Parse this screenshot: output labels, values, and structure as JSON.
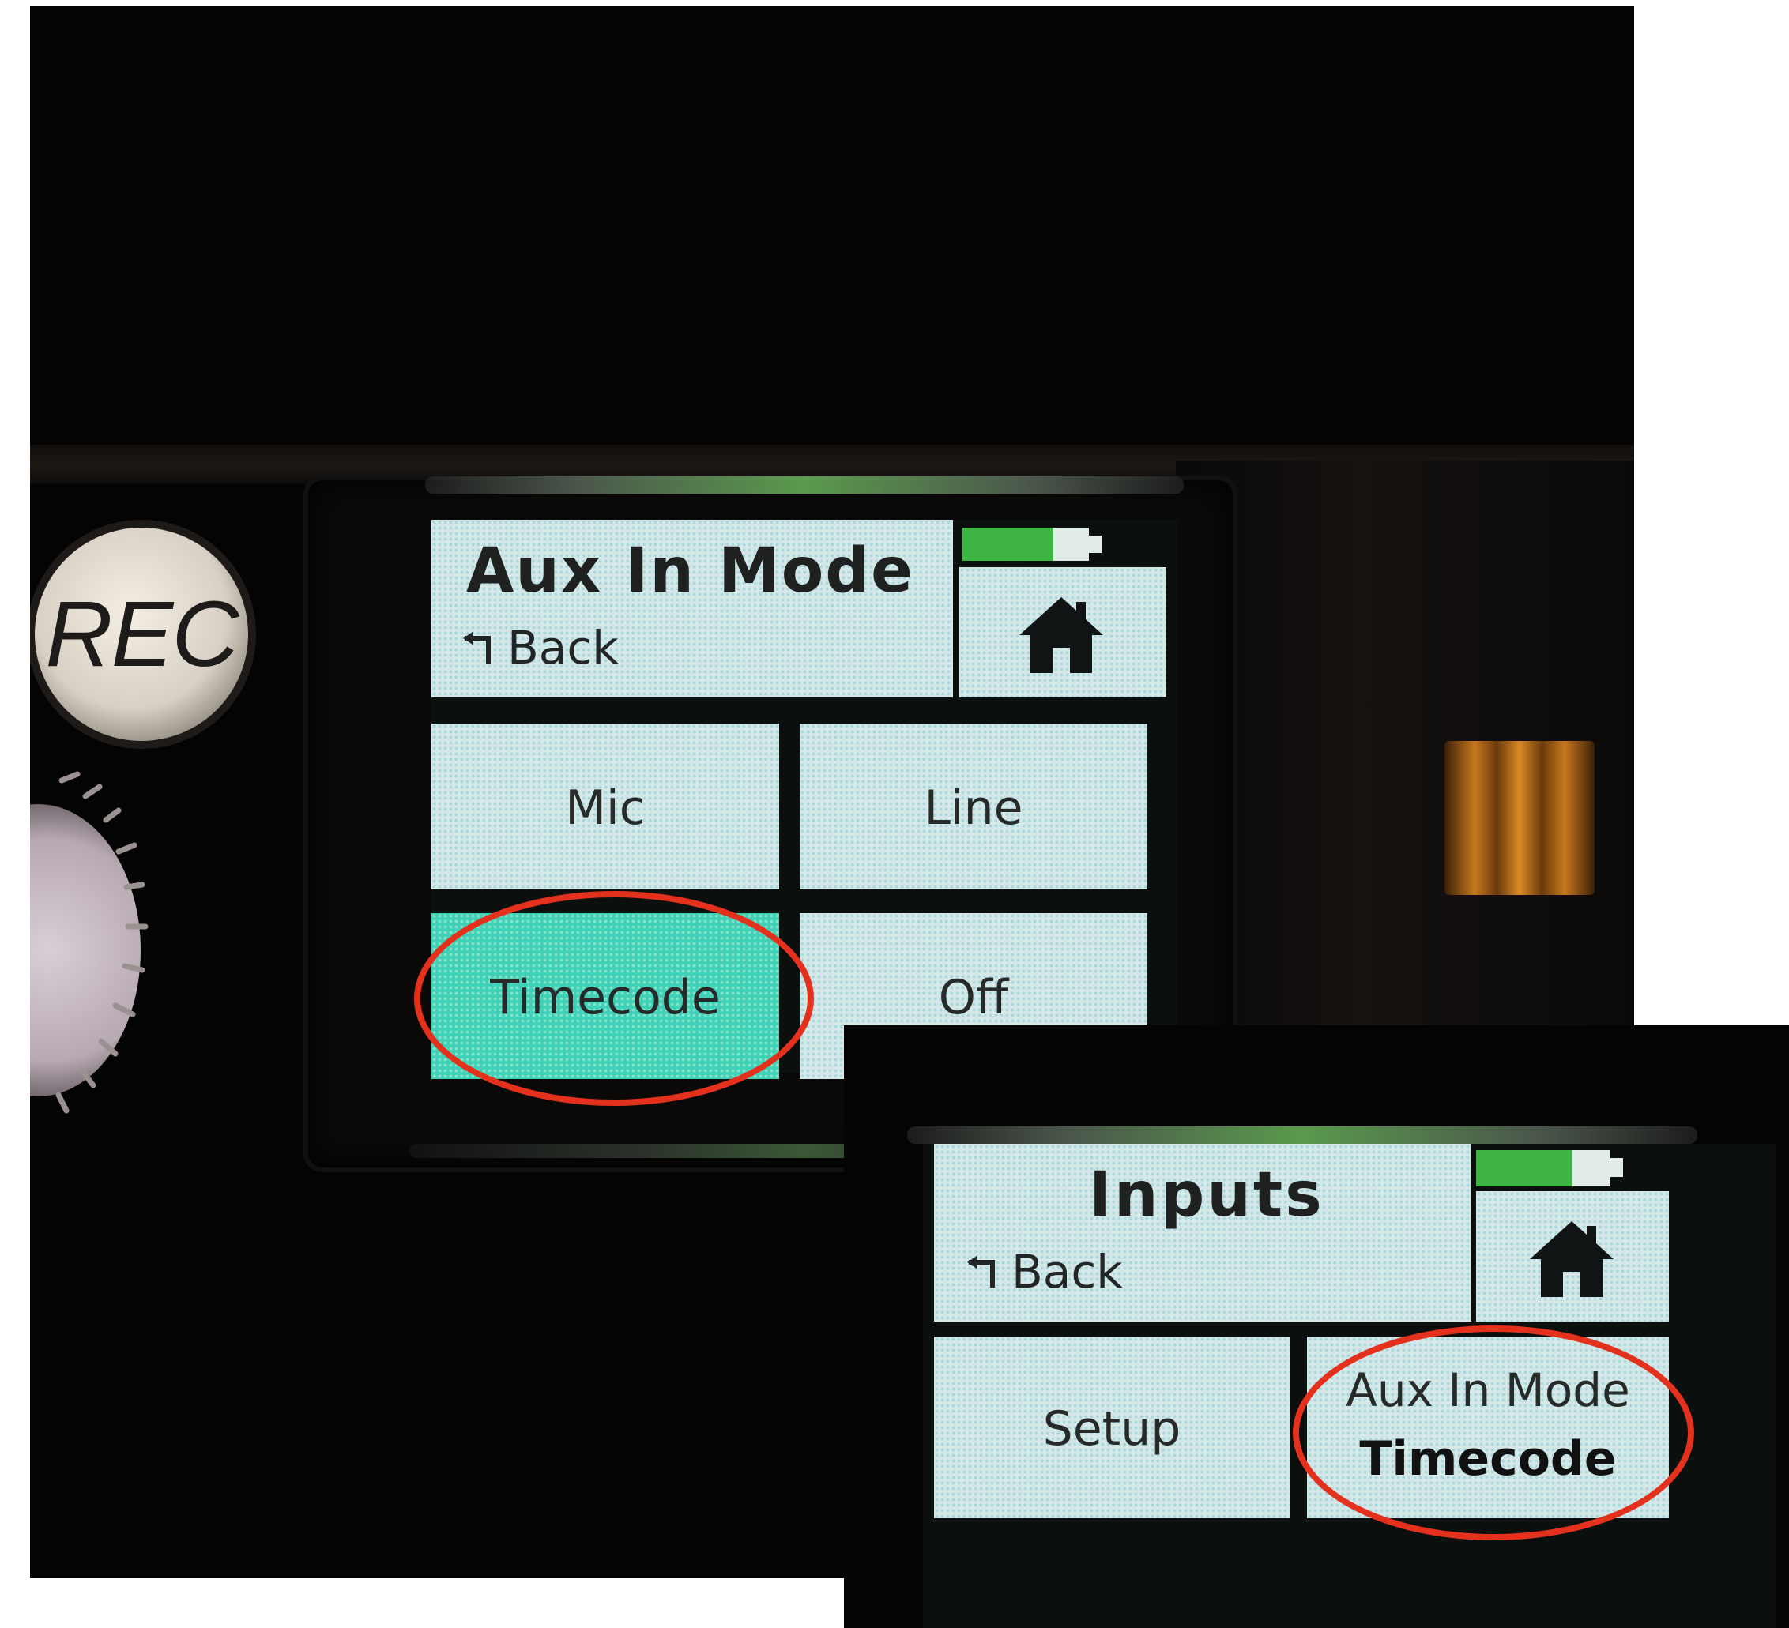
{
  "main_screen": {
    "title": "Aux In Mode",
    "back_label": "Back",
    "options": [
      {
        "label": "Mic"
      },
      {
        "label": "Line"
      },
      {
        "label": "Timecode",
        "selected": true
      },
      {
        "label": "Off"
      }
    ],
    "rec_label": "REC",
    "battery_level": 0.72
  },
  "inset_screen": {
    "title": "Inputs",
    "back_label": "Back",
    "setup_label": "Setup",
    "aux_mode_label": "Aux In Mode",
    "aux_mode_value": "Timecode",
    "battery_level": 0.72
  },
  "colors": {
    "highlight_circle": "#e3311d",
    "battery_fill": "#3fb544",
    "selected_tile": "#3fd0b8",
    "tile": "#d5e7e6"
  }
}
